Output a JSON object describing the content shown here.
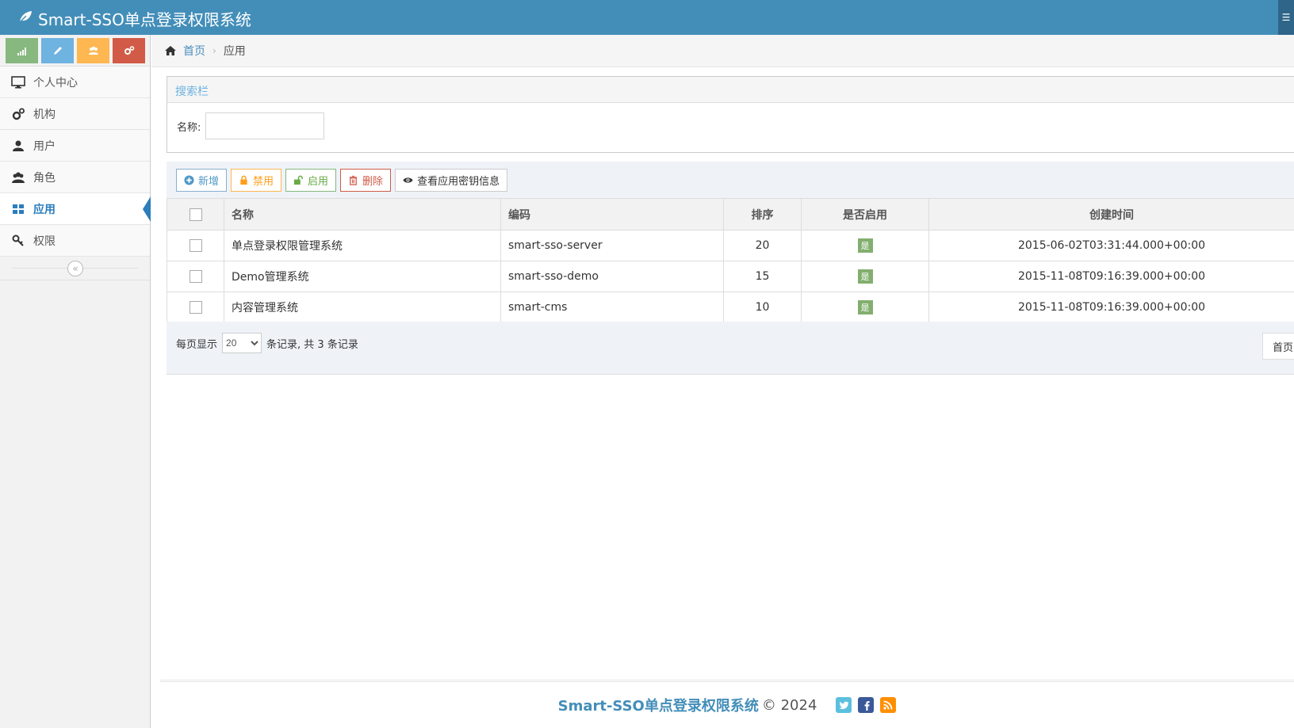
{
  "app": {
    "title": "Smart-SSO单点登录权限系统"
  },
  "sidebar": {
    "shortcuts": [
      {
        "icon": "signal-icon",
        "color": "#87b87f"
      },
      {
        "icon": "pencil-icon",
        "color": "#6fb3e0"
      },
      {
        "icon": "group-icon",
        "color": "#ffb752"
      },
      {
        "icon": "cogs-icon",
        "color": "#d15b47"
      }
    ],
    "items": [
      {
        "label": "个人中心",
        "icon": "desktop-icon"
      },
      {
        "label": "机构",
        "icon": "cogs-icon"
      },
      {
        "label": "用户",
        "icon": "user-icon"
      },
      {
        "label": "角色",
        "icon": "users-icon"
      },
      {
        "label": "应用",
        "icon": "apps-icon",
        "active": true
      },
      {
        "label": "权限",
        "icon": "key-icon"
      }
    ],
    "collapse_glyph": "«"
  },
  "breadcrumb": {
    "home": "首页",
    "current": "应用",
    "separator": "›"
  },
  "search": {
    "header": "搜索栏",
    "name_label": "名称:",
    "name_value": ""
  },
  "toolbar": {
    "add": "新增",
    "disable": "禁用",
    "enable": "启用",
    "delete": "删除",
    "view_secret": "查看应用密钥信息"
  },
  "table": {
    "headers": {
      "name": "名称",
      "code": "编码",
      "sort": "排序",
      "enabled": "是否启用",
      "created": "创建时间"
    },
    "rows": [
      {
        "name": "单点登录权限管理系统",
        "code": "smart-sso-server",
        "sort": "20",
        "enabled": "是",
        "created": "2015-06-02T03:31:44.000+00:00"
      },
      {
        "name": "Demo管理系统",
        "code": "smart-sso-demo",
        "sort": "15",
        "enabled": "是",
        "created": "2015-11-08T09:16:39.000+00:00"
      },
      {
        "name": "内容管理系统",
        "code": "smart-cms",
        "sort": "10",
        "enabled": "是",
        "created": "2015-11-08T09:16:39.000+00:00"
      }
    ]
  },
  "pager": {
    "per_page_prefix": "每页显示",
    "per_page_value": "20",
    "per_page_suffix": "条记录,  共 3 条记录",
    "first": "首页"
  },
  "footer": {
    "brand": "Smart-SSO单点登录权限系统",
    "copyright": "© 2024"
  },
  "colors": {
    "navbar": "#438eb9",
    "accent": "#2b7dbc",
    "badge_green": "#82af6f"
  }
}
